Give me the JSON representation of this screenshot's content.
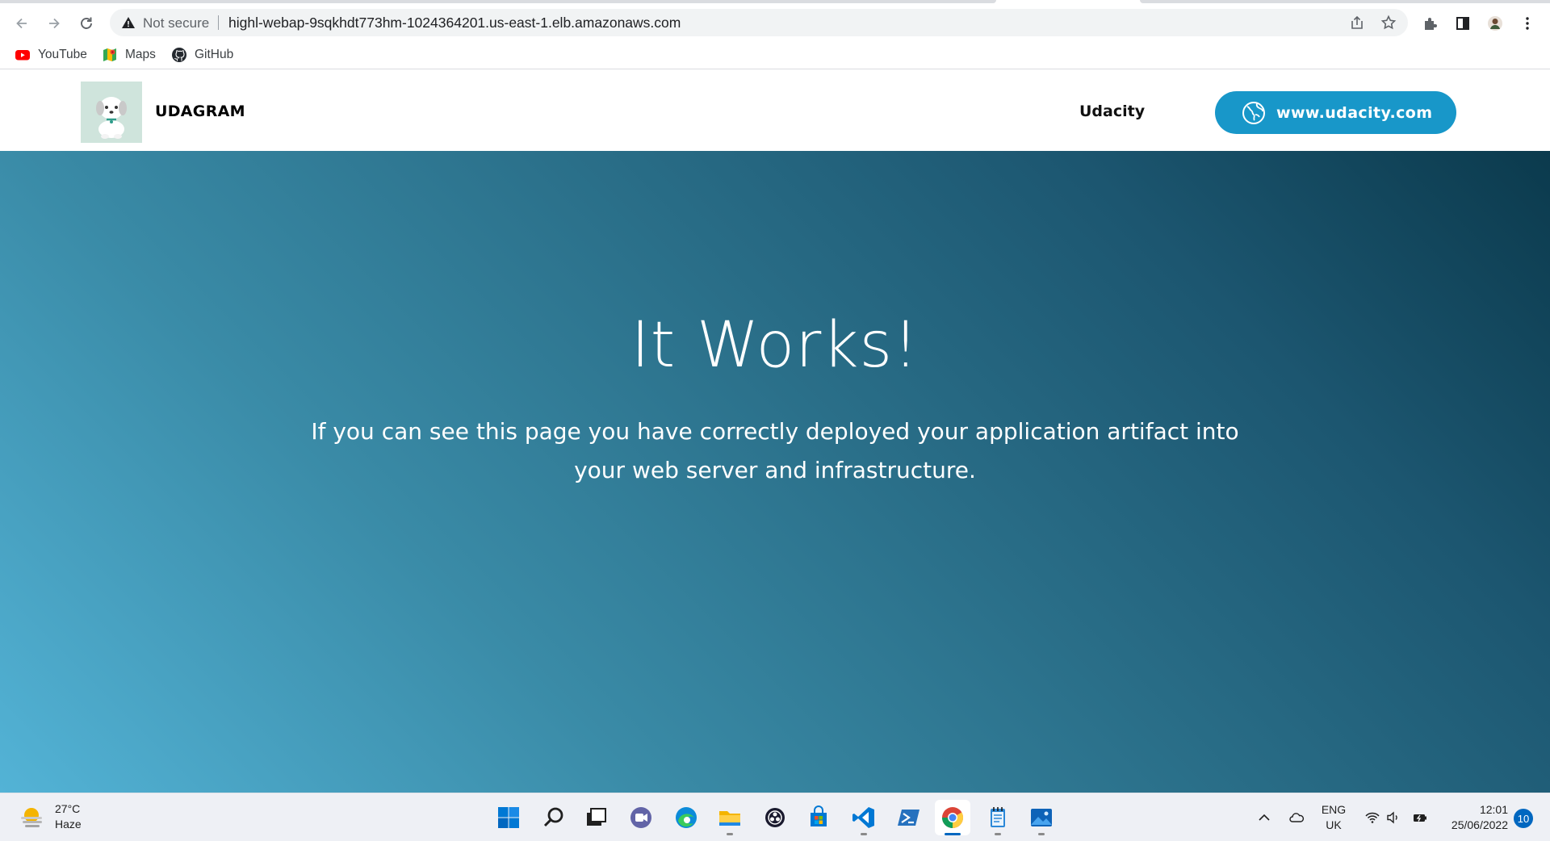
{
  "browser": {
    "security_label": "Not secure",
    "url": "highl-webap-9sqkhdt773hm-1024364201.us-east-1.elb.amazonaws.com",
    "bookmarks": [
      {
        "label": "YouTube",
        "icon": "youtube-icon"
      },
      {
        "label": "Maps",
        "icon": "maps-icon"
      },
      {
        "label": "GitHub",
        "icon": "github-icon"
      }
    ]
  },
  "site": {
    "brand": "UDAGRAM",
    "nav_link": "Udacity",
    "cta_label": "www.udacity.com",
    "accent_color": "#1897c9"
  },
  "hero": {
    "title": "It Works!",
    "text": "If you can see this page you have correctly deployed your application artifact into your web server and infrastructure.",
    "gradient_start": "#53b3d6",
    "gradient_end": "#0b3a4d"
  },
  "taskbar": {
    "weather_temp": "27°C",
    "weather_desc": "Haze",
    "lang_top": "ENG",
    "lang_bottom": "UK",
    "time": "12:01",
    "date": "25/06/2022",
    "notifications": "10",
    "apps": [
      "windows-start",
      "search",
      "task-view",
      "teams-chat",
      "edge",
      "file-explorer",
      "obs",
      "microsoft-store",
      "vscode",
      "powershell",
      "chrome",
      "notepad",
      "photos"
    ]
  }
}
